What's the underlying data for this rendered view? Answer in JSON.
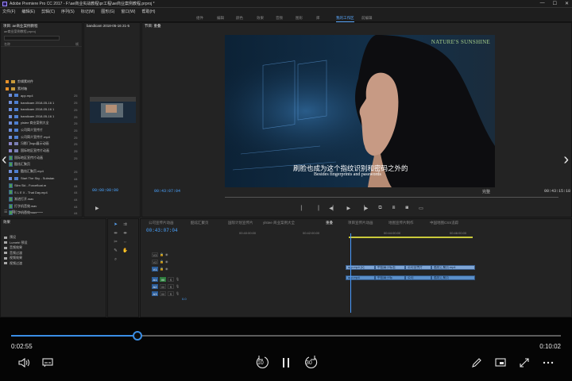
{
  "window": {
    "title": "Adobe Premiere Pro CC 2017 - F:\\ae商业实战教程\\pr工程\\ae商业案例教程.prproj *"
  },
  "menu": [
    "文件(F)",
    "编辑(E)",
    "剪辑(C)",
    "序列(S)",
    "标记(M)",
    "图形(G)",
    "窗口(W)",
    "帮助(H)"
  ],
  "workspaces": [
    "组件",
    "编辑",
    "颜色",
    "效果",
    "音频",
    "图形",
    "库",
    "我的工作区",
    "前编辑"
  ],
  "workspace_active": "我的工作区",
  "project": {
    "tab": "项目: ae商业案例教程",
    "file": "ae商业案例教程.prproj",
    "col_name": "名称",
    "col_rate": "帧",
    "items": [
      {
        "name": "剪辑素材件",
        "color": "#e8912a",
        "icon": "folder",
        "val": ""
      },
      {
        "name": "素材箱",
        "color": "#e8912a",
        "icon": "folder",
        "val": ""
      },
      {
        "name": "app.mp4",
        "color": "#6f8ed8",
        "icon": "video",
        "val": "25"
      },
      {
        "name": "bandicam 2018-05-16 1",
        "color": "#6f8ed8",
        "icon": "video",
        "val": "25"
      },
      {
        "name": "bandicam 2018-05-16 1",
        "color": "#6f8ed8",
        "icon": "video",
        "val": "25"
      },
      {
        "name": "bandicam 2018-05-16 1",
        "color": "#6f8ed8",
        "icon": "video",
        "val": "25"
      },
      {
        "name": "ylstee 商业案例大全",
        "color": "#6f8ed8",
        "icon": "video",
        "val": "25"
      },
      {
        "name": "公司简介宣传片",
        "color": "#6f8ed8",
        "icon": "video",
        "val": "25"
      },
      {
        "name": "公司简介宣传片.mp4",
        "color": "#6f8ed8",
        "icon": "video",
        "val": "25"
      },
      {
        "name": "冯影门logo展示动画",
        "color": "#8c86c9",
        "icon": "image",
        "val": "25"
      },
      {
        "name": "国际地区宣传片动画",
        "color": "#8c86c9",
        "icon": "image",
        "val": "25"
      },
      {
        "name": "国际地区宣传片动画",
        "color": "#3fa84f",
        "icon": "clip",
        "val": "25"
      },
      {
        "name": "酷炫汇聚页",
        "color": "#3fa84f",
        "icon": "clip",
        "val": ""
      },
      {
        "name": "酷炫汇聚页.mp4",
        "color": "#6f8ed8",
        "icon": "video",
        "val": "25"
      },
      {
        "name": "Start The Sky - Substan",
        "color": "#6f8ed8",
        "icon": "video",
        "val": "44"
      },
      {
        "name": "Slim Ski - Forcefloat.m",
        "color": "#3fa84f",
        "icon": "clip",
        "val": "44"
      },
      {
        "name": "S L E X - That Day.mp4",
        "color": "#3fa84f",
        "icon": "clip",
        "val": "44"
      },
      {
        "name": "渐进打开.wav",
        "color": "#3fa84f",
        "icon": "clip",
        "val": "44"
      },
      {
        "name": "打字机音效.wav",
        "color": "#3fa84f",
        "icon": "clip",
        "val": "44"
      },
      {
        "name": "打字机音效.wav",
        "color": "#3fa84f",
        "icon": "clip",
        "val": "44"
      }
    ]
  },
  "source": {
    "tab": "bandicam 2018-05-16 21-5",
    "timecode": "00:00:00:00"
  },
  "program": {
    "tab": "节目: 重叠",
    "timecode": "00:43:07:04",
    "duration": "00:43:15:18",
    "fit": "完整",
    "subtitle_cn": "刷脸也成为这个指纹识别和密码之外的",
    "subtitle_en": "Besides fingerprints and passwords",
    "brand": "NATURE'S SUNSHINE"
  },
  "effects": {
    "tab": "效果",
    "items": [
      "预设",
      "Lumetri 预设",
      "音频效果",
      "音频过渡",
      "视频效果",
      "视频过渡"
    ]
  },
  "timeline": {
    "tabs": [
      "公司宣传片动画",
      "酷炫汇聚页",
      "国际计划宣传片",
      "ylstee 商业案例大全",
      "重叠",
      "项目宣传片动画",
      "地图宣传片制作",
      "中国地图CSS追踪"
    ],
    "active_tab": "重叠",
    "timecode": "00:43:07:04",
    "ruler": [
      "00:40:00:00",
      "00:42:00:00",
      "00:44:00:00",
      "00:46:00:00"
    ],
    "video_tracks": [
      "V3",
      "V2",
      "V1"
    ],
    "audio_tracks": [
      "A1",
      "A2",
      "A3"
    ],
    "master": "0.0",
    "clips_v": [
      {
        "label": "app.mp4 [V]"
      },
      {
        "label": "中国高于标志"
      },
      {
        "label": "公司宣传片"
      },
      {
        "label": "酷炫汇聚页.mp4"
      }
    ],
    "clips_a": [
      {
        "label": "app.mp4"
      },
      {
        "label": "中国高于标"
      },
      {
        "label": "公司"
      },
      {
        "label": "酷炫汇聚页"
      }
    ]
  },
  "player": {
    "elapsed": "0:02:55",
    "total": "0:10:02",
    "progress": 0.23
  },
  "icons": {
    "prev": "chevron-left-icon",
    "next": "chevron-right-icon",
    "volume": "volume-icon",
    "subtitles": "subtitles-icon",
    "rewind": "rewind-10-icon",
    "pause": "pause-icon",
    "forward": "forward-30-icon",
    "pen": "pen-icon",
    "cast": "cast-icon",
    "fullscreen": "fullscreen-icon",
    "more": "more-icon"
  },
  "skip_back": "10",
  "skip_fwd": "30"
}
